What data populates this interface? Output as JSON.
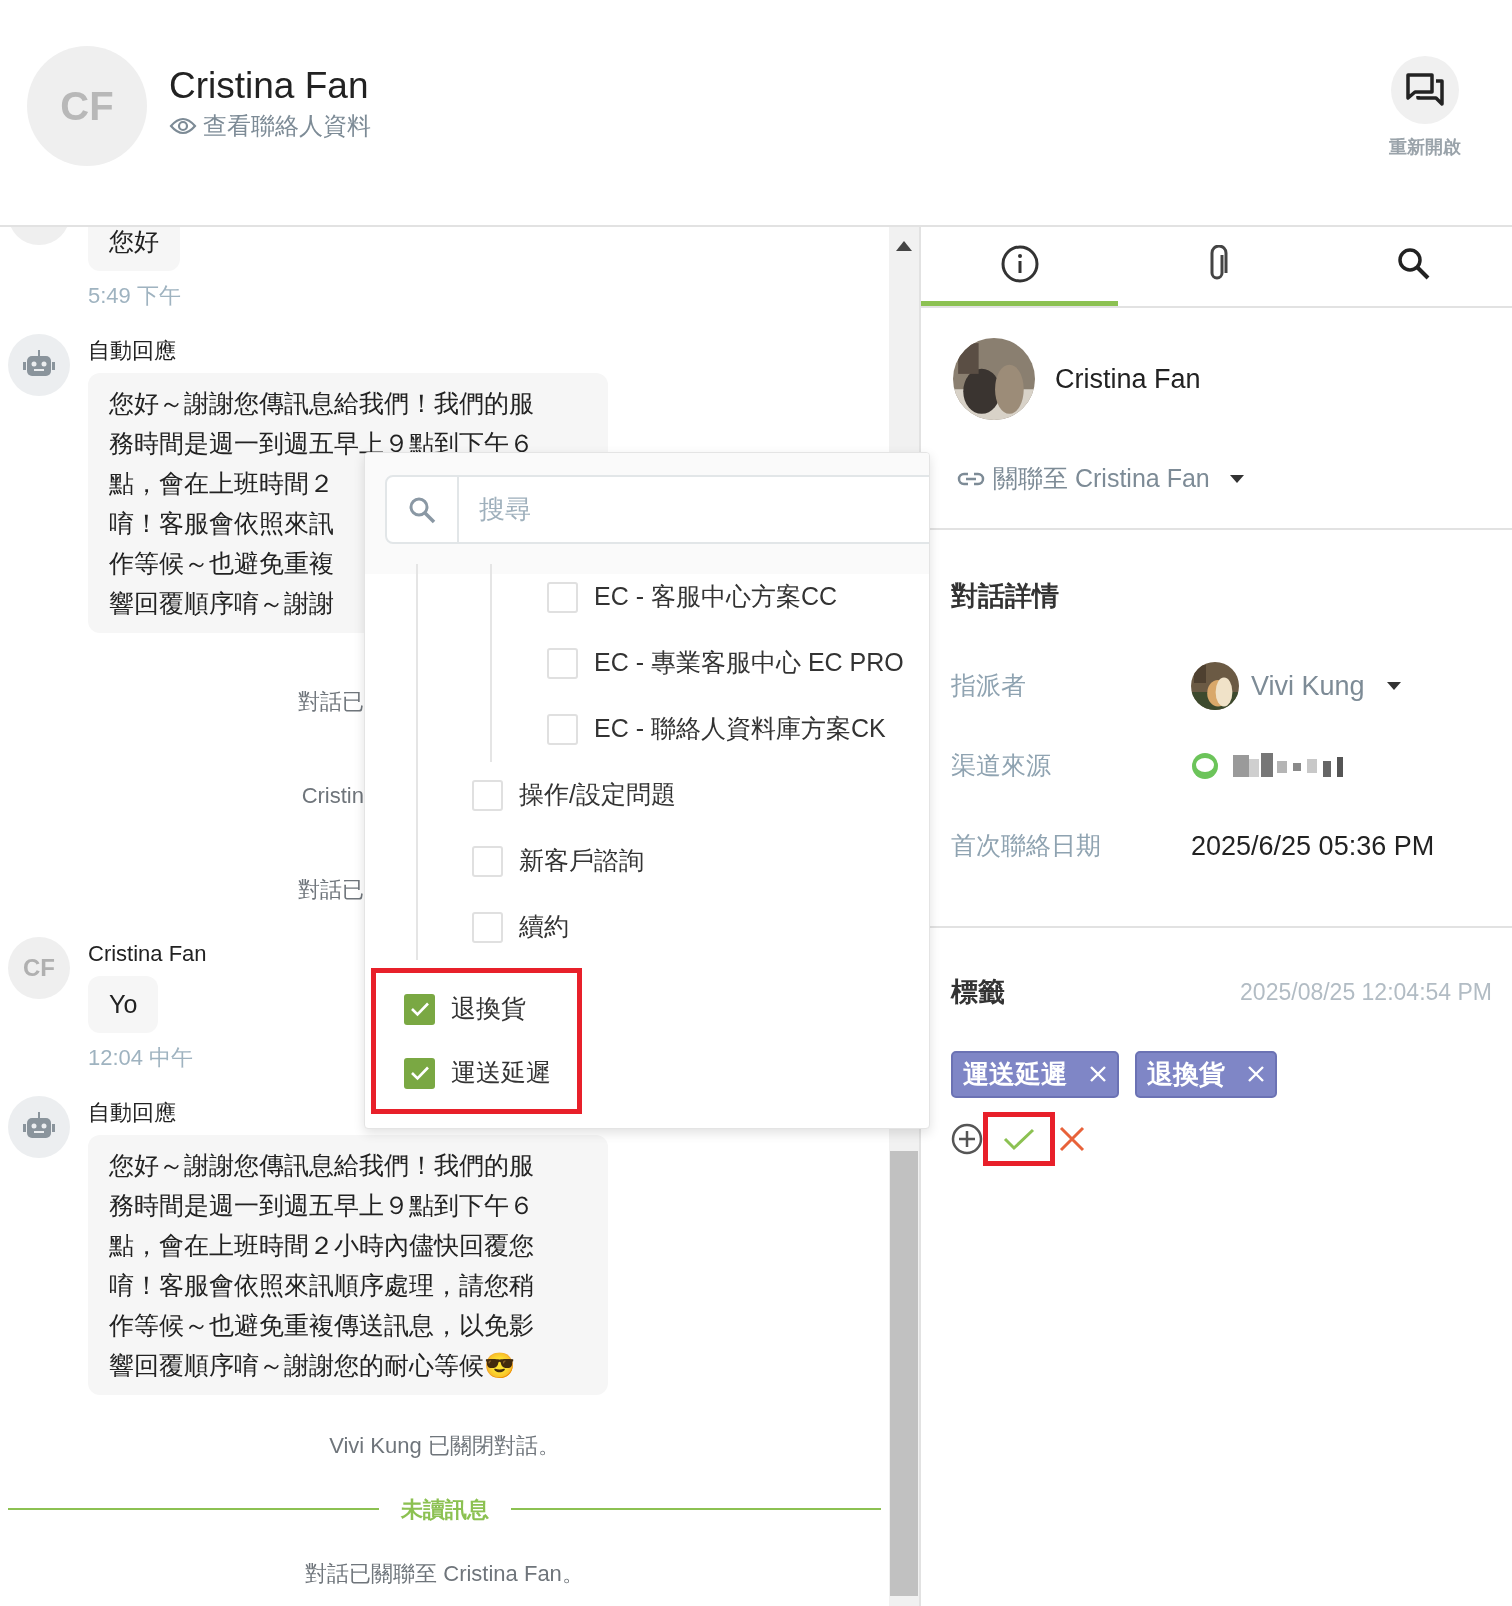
{
  "header": {
    "avatar_initials": "CF",
    "name": "Cristina Fan",
    "view_link": "查看聯絡人資料",
    "reopen_label": "重新開啟"
  },
  "messages": [
    {
      "kind": "contact",
      "text_lines": [
        "您好"
      ],
      "time": "5:49 下午"
    },
    {
      "kind": "bot",
      "sender": "自動回應",
      "text_lines": [
        "您好～謝謝您傳訊息給我們！我們的服",
        "務時間是週一到週五早上９點到下午６",
        "點，會在上班時間２",
        "唷！客服會依照來訊",
        "作等候～也避免重複",
        "響回覆順序唷～謝謝"
      ]
    },
    {
      "kind": "system_cut",
      "text": "對話已"
    },
    {
      "kind": "system_cut",
      "text": "Cristin"
    },
    {
      "kind": "system_cut",
      "text": "對話已"
    },
    {
      "kind": "contact",
      "avatar_initials": "CF",
      "sender": "Cristina Fan",
      "text_lines": [
        "Yo"
      ],
      "time": "12:04 中午"
    },
    {
      "kind": "bot",
      "sender": "自動回應",
      "text_lines": [
        "您好～謝謝您傳訊息給我們！我們的服",
        "務時間是週一到週五早上９點到下午６",
        "點，會在上班時間２小時內儘快回覆您",
        "唷！客服會依照來訊順序處理，請您稍",
        "作等候～也避免重複傳送訊息，以免影",
        "響回覆順序唷～謝謝您的耐心等候😎"
      ]
    },
    {
      "kind": "system",
      "text": "Vivi Kung 已關閉對話。"
    },
    {
      "kind": "divider",
      "text": "未讀訊息"
    },
    {
      "kind": "system",
      "text": "對話已關聯至 Cristina Fan。"
    }
  ],
  "tag_dropdown": {
    "search_placeholder": "搜尋",
    "annotation_box": true,
    "options": [
      {
        "children": [
          {
            "children": [
              {
                "label": "EC - 客服中心方案CC",
                "checked": false
              },
              {
                "label": "EC - 專業客服中心 EC PRO",
                "checked": false
              },
              {
                "label": "EC - 聯絡人資料庫方案CK",
                "checked": false
              }
            ]
          },
          {
            "label": "操作/設定問題",
            "checked": false
          },
          {
            "label": "新客戶諮詢",
            "checked": false
          },
          {
            "label": "續約",
            "checked": false
          }
        ]
      },
      {
        "label": "退換貨",
        "checked": true
      },
      {
        "label": "運送延遲",
        "checked": true
      }
    ]
  },
  "panel": {
    "tabs": [
      {
        "selected": true
      },
      {
        "selected": false
      },
      {
        "selected": false
      }
    ],
    "contact_name": "Cristina Fan",
    "link_label": "關聯至 Cristina Fan",
    "details_title": "對話詳情",
    "details": [
      {
        "kind": "assignee",
        "label": "指派者",
        "value": "Vivi Kung"
      },
      {
        "kind": "channel",
        "label": "渠道來源"
      },
      {
        "kind": "text",
        "label": "首次聯絡日期",
        "value": "2025/6/25 05:36 PM"
      }
    ],
    "tags_title": "標籤",
    "tags_time": "2025/08/25 12:04:54 PM",
    "tags": [
      {
        "label": "運送延遲"
      },
      {
        "label": "退換貨"
      }
    ],
    "confirm_annotated": true
  }
}
